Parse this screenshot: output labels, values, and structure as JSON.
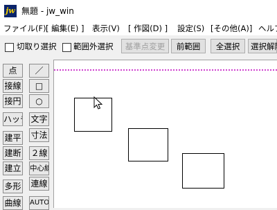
{
  "window": {
    "icon_text": "jw",
    "title": "無題 - jw_win"
  },
  "menu": [
    "ファイル(F)",
    "[ 編集(E) ]",
    "表示(V)",
    "[ 作図(D) ]",
    "設定(S)",
    "[その他(A)]",
    "ヘルプ"
  ],
  "toolbar": {
    "checkbox_cut_select": "切取り選択",
    "checkbox_outside_range": "範囲外選択",
    "btn_change_base": "基準点変更",
    "btn_prev_range": "前範囲",
    "btn_select_all": "全選択",
    "btn_deselect": "選択解除"
  },
  "left_tools_col1": [
    "点",
    "接線",
    "接円",
    "ハッチ",
    "建平",
    "建断",
    "建立",
    "多形",
    "曲線"
  ],
  "left_tools_col2": [
    "／",
    "□",
    "○",
    "文字",
    "寸法",
    "２線",
    "中心線",
    "連線",
    "AUTO"
  ],
  "colors": {
    "guide": "#d040d0",
    "icon_bg": "#0a246a",
    "icon_fg": "#f5d000"
  }
}
